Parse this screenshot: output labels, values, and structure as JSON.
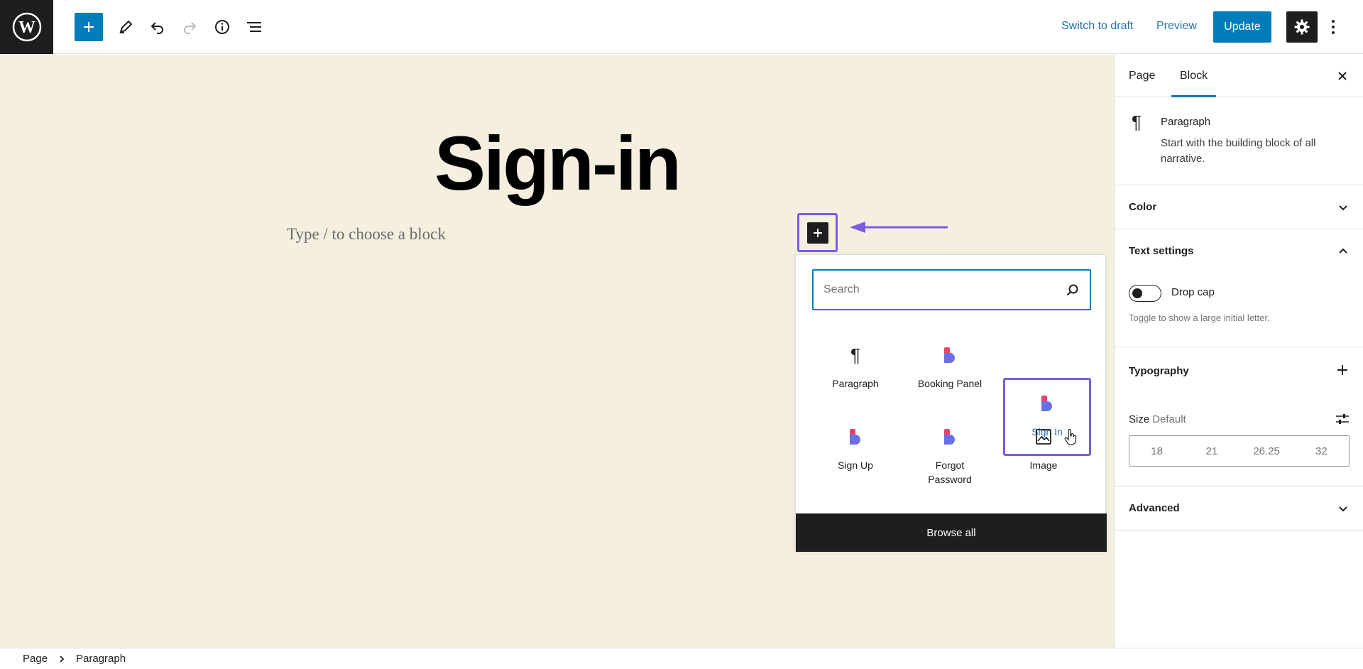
{
  "toolbar": {
    "switch_to_draft": "Switch to draft",
    "preview": "Preview",
    "update": "Update"
  },
  "canvas": {
    "title": "Sign-in",
    "placeholder": "Type / to choose a block"
  },
  "inserter": {
    "search_placeholder": "Search",
    "blocks": [
      {
        "label": "Paragraph",
        "icon": "paragraph-icon"
      },
      {
        "label": "Booking Panel",
        "icon": "plugin-block-icon"
      },
      {
        "label": "Sign In",
        "icon": "plugin-block-icon",
        "highlighted": true
      },
      {
        "label": "Sign Up",
        "icon": "plugin-block-icon"
      },
      {
        "label": "Forgot\nPassword",
        "icon": "plugin-block-icon"
      },
      {
        "label": "Image",
        "icon": "image-icon"
      }
    ],
    "browse_all": "Browse all"
  },
  "sidebar": {
    "tabs": [
      "Page",
      "Block"
    ],
    "active_tab": "Block",
    "block_name": "Paragraph",
    "block_description": "Start with the building block of all narrative.",
    "panels": {
      "color": "Color",
      "text_settings": "Text settings",
      "drop_cap": "Drop cap",
      "drop_cap_help": "Toggle to show a large initial letter.",
      "typography": "Typography",
      "size_label": "Size",
      "size_value": "Default",
      "font_sizes": [
        "18",
        "21",
        "26.25",
        "32"
      ],
      "advanced": "Advanced"
    }
  },
  "breadcrumb": [
    "Page",
    "Paragraph"
  ],
  "colors": {
    "accent": "#007cba",
    "highlight": "#7a5de0",
    "canvas_bg": "#f5efe0",
    "dark": "#1e1e1e"
  }
}
